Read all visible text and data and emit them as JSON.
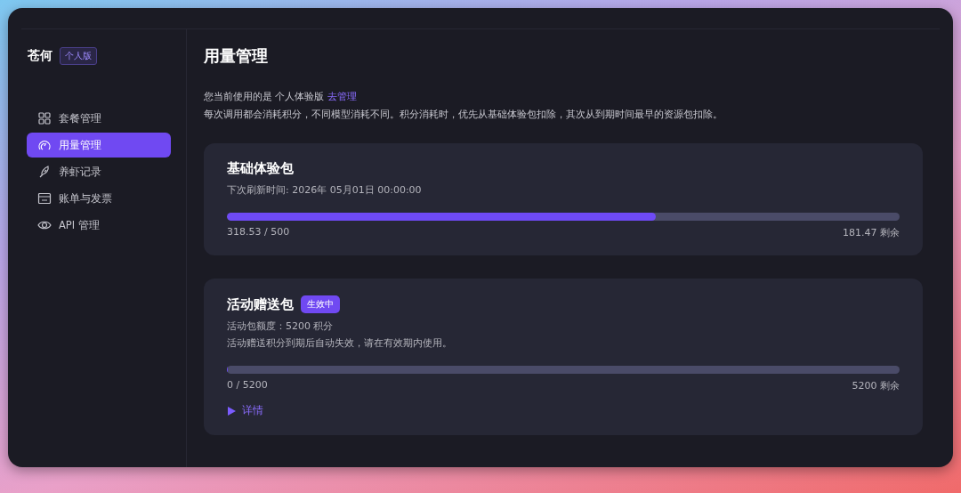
{
  "brand": {
    "name": "苍何",
    "badge": "个人版"
  },
  "sidebar": {
    "items": [
      {
        "label": "套餐管理",
        "selected": false
      },
      {
        "label": "用量管理",
        "selected": true
      },
      {
        "label": "养虾记录",
        "selected": false
      },
      {
        "label": "账单与发票",
        "selected": false
      },
      {
        "label": "API 管理",
        "selected": false
      }
    ]
  },
  "page": {
    "title": "用量管理",
    "plan_text": "您当前使用的是 个人体验版",
    "plan_link": "去管理",
    "note": "每次调用都会消耗积分，不同模型消耗不同。积分消耗时，优先从基础体验包扣除，其次从到期时间最早的资源包扣除。"
  },
  "packs": [
    {
      "title": "基础体验包",
      "lines": [
        "下次刷新时间: 2026年 05月01日 00:00:00"
      ],
      "level": 0.6371,
      "used": "318.53 / 500",
      "remaining": "181.47 剩余"
    },
    {
      "title": "活动赠送包",
      "badge": "生效中",
      "lines": [
        "活动包额度：5200 积分",
        "活动赠送积分到期后自动失效，请在有效期内使用。"
      ],
      "level": 0,
      "used": "0 / 5200",
      "remaining": "5200 剩余",
      "details": "详情"
    }
  ]
}
